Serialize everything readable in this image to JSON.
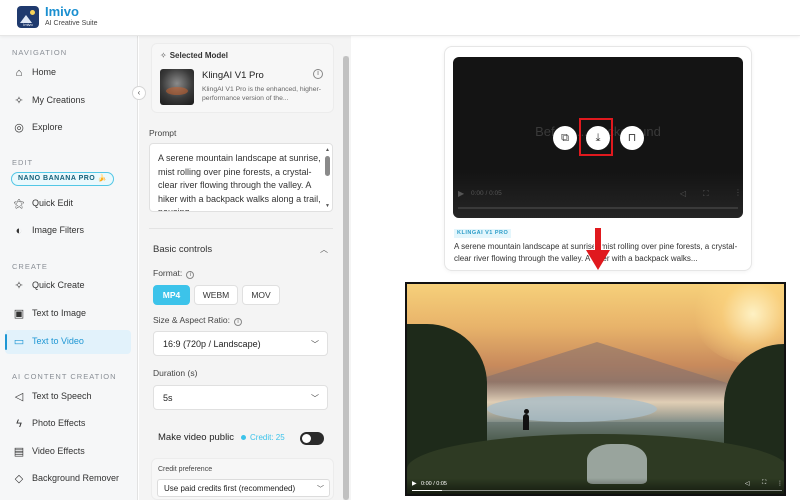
{
  "header": {
    "logo_text": "Imivo",
    "brand": "Imivo",
    "tagline": "AI Creative Suite"
  },
  "sidebar": {
    "sections": {
      "navigation": "NAVIGATION",
      "edit": "EDIT",
      "create": "CREATE",
      "ai_content_creation": "AI CONTENT CREATION"
    },
    "badge": "NANO BANANA PRO 🍌",
    "items": [
      {
        "label": "Home",
        "icon": "home-icon"
      },
      {
        "label": "My Creations",
        "icon": "sparkles-icon"
      },
      {
        "label": "Explore",
        "icon": "compass-icon"
      },
      {
        "label": "Quick Edit",
        "icon": "magic-wand-icon"
      },
      {
        "label": "Image Filters",
        "icon": "palette-icon"
      },
      {
        "label": "Quick Create",
        "icon": "sparkles-icon"
      },
      {
        "label": "Text to Image",
        "icon": "image-icon"
      },
      {
        "label": "Text to Video",
        "icon": "video-icon",
        "active": true
      },
      {
        "label": "Text to Speech",
        "icon": "speaker-icon"
      },
      {
        "label": "Photo Effects",
        "icon": "lightning-icon"
      },
      {
        "label": "Video Effects",
        "icon": "film-icon"
      },
      {
        "label": "Background Remover",
        "icon": "eraser-icon"
      }
    ],
    "accent": "#1f97d4"
  },
  "settings": {
    "selected_model_label": "Selected Model",
    "model_name": "KlingAI V1 Pro",
    "model_desc": "KlingAI V1 Pro is the enhanced, higher-performance version of the...",
    "prompt_label": "Prompt",
    "prompt_text": "A serene mountain landscape at sunrise, mist rolling over pine forests, a crystal-clear river flowing through the valley. A hiker with a backpack walks along a trail, pausing",
    "basic_controls": "Basic controls",
    "format_label": "Format:",
    "formats": [
      "MP4",
      "WEBM",
      "MOV"
    ],
    "selected_format": "MP4",
    "size_label": "Size & Aspect Ratio:",
    "size_value": "16:9 (720p / Landscape)",
    "duration_label": "Duration (s)",
    "duration_value": "5s",
    "public_label": "Make video public",
    "credit_text": "Credit: 25",
    "credit_pref_label": "Credit preference",
    "credit_pref_value": "Use paid credits first (recommended)",
    "accent": "#3cc3ea"
  },
  "preview": {
    "ghost_text": "Before ... Background",
    "dark_video_time": "0:00 / 0:05",
    "model_tag": "KLINGAI V1 PRO",
    "description": "A serene mountain landscape at sunrise, mist rolling over pine forests, a crystal-clear river flowing through the valley. A hiker with a backpack walks...",
    "photo_time": "0:00 / 0:05",
    "photo_progress": 0.08,
    "highlight_color": "#e0191e"
  }
}
